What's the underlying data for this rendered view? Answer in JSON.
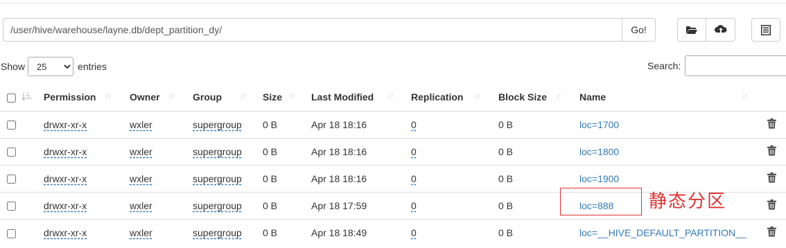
{
  "path": {
    "value": "/user/hive/warehouse/layne.db/dept_partition_dy/",
    "go_label": "Go!"
  },
  "toolbar": {
    "icons": [
      "folder-open-icon",
      "cloud-upload-icon",
      "list-alt-icon"
    ]
  },
  "length": {
    "show_label": "Show",
    "selected": "25",
    "entries_label": "entries"
  },
  "search": {
    "label": "Search:"
  },
  "table": {
    "columns": [
      "Permission",
      "Owner",
      "Group",
      "Size",
      "Last Modified",
      "Replication",
      "Block Size",
      "Name"
    ],
    "rows": [
      {
        "permission": "drwxr-xr-x",
        "owner": "wxler",
        "group": "supergroup",
        "size": "0 B",
        "modified": "Apr 18 18:16",
        "replication": "0",
        "block_size": "0 B",
        "name": "loc=1700"
      },
      {
        "permission": "drwxr-xr-x",
        "owner": "wxler",
        "group": "supergroup",
        "size": "0 B",
        "modified": "Apr 18 18:16",
        "replication": "0",
        "block_size": "0 B",
        "name": "loc=1800"
      },
      {
        "permission": "drwxr-xr-x",
        "owner": "wxler",
        "group": "supergroup",
        "size": "0 B",
        "modified": "Apr 18 18:16",
        "replication": "0",
        "block_size": "0 B",
        "name": "loc=1900"
      },
      {
        "permission": "drwxr-xr-x",
        "owner": "wxler",
        "group": "supergroup",
        "size": "0 B",
        "modified": "Apr 18 17:59",
        "replication": "0",
        "block_size": "0 B",
        "name": "loc=888"
      },
      {
        "permission": "drwxr-xr-x",
        "owner": "wxler",
        "group": "supergroup",
        "size": "0 B",
        "modified": "Apr 18 18:49",
        "replication": "0",
        "block_size": "0 B",
        "name": "loc=__HIVE_DEFAULT_PARTITION__"
      }
    ]
  },
  "annotation": {
    "text": "静态分区",
    "color": "#e03030"
  },
  "colors": {
    "link": "#337ab7",
    "border": "#cccccc"
  }
}
